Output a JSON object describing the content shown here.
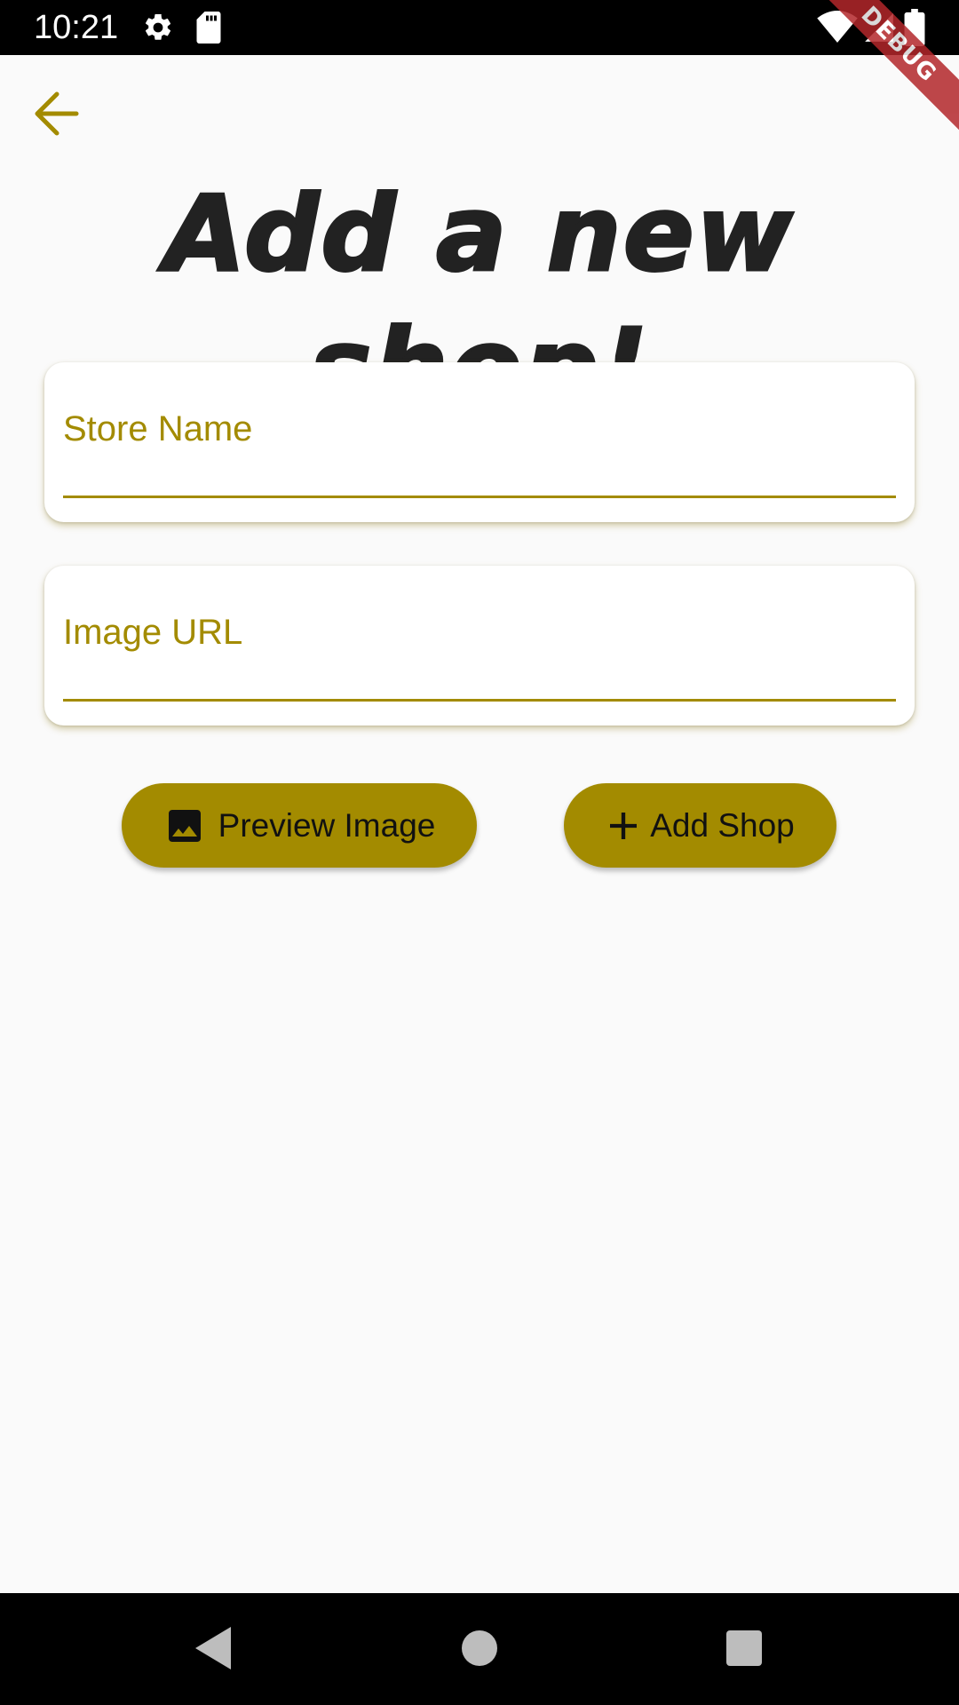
{
  "status_bar": {
    "time": "10:21",
    "icons": [
      "gear-icon",
      "sd-card-icon",
      "wifi-icon",
      "signal-icon",
      "battery-icon"
    ]
  },
  "debug_banner": {
    "label": "DEBUG"
  },
  "header": {
    "back_icon": "arrow-left-icon",
    "title": "Add a new shop!"
  },
  "form": {
    "store_name": {
      "label": "Store Name",
      "value": ""
    },
    "image_url": {
      "label": "Image URL",
      "value": ""
    }
  },
  "actions": {
    "preview": {
      "label": "Preview Image",
      "icon": "image-icon"
    },
    "add": {
      "label": "Add Shop",
      "icon": "plus-icon"
    }
  },
  "nav_bar": {
    "icons": [
      "back-triangle-icon",
      "home-circle-icon",
      "recents-square-icon"
    ]
  },
  "colors": {
    "accent": "#a38b00",
    "background": "#fafafa",
    "title": "#222222",
    "debug": "#b3272b"
  }
}
